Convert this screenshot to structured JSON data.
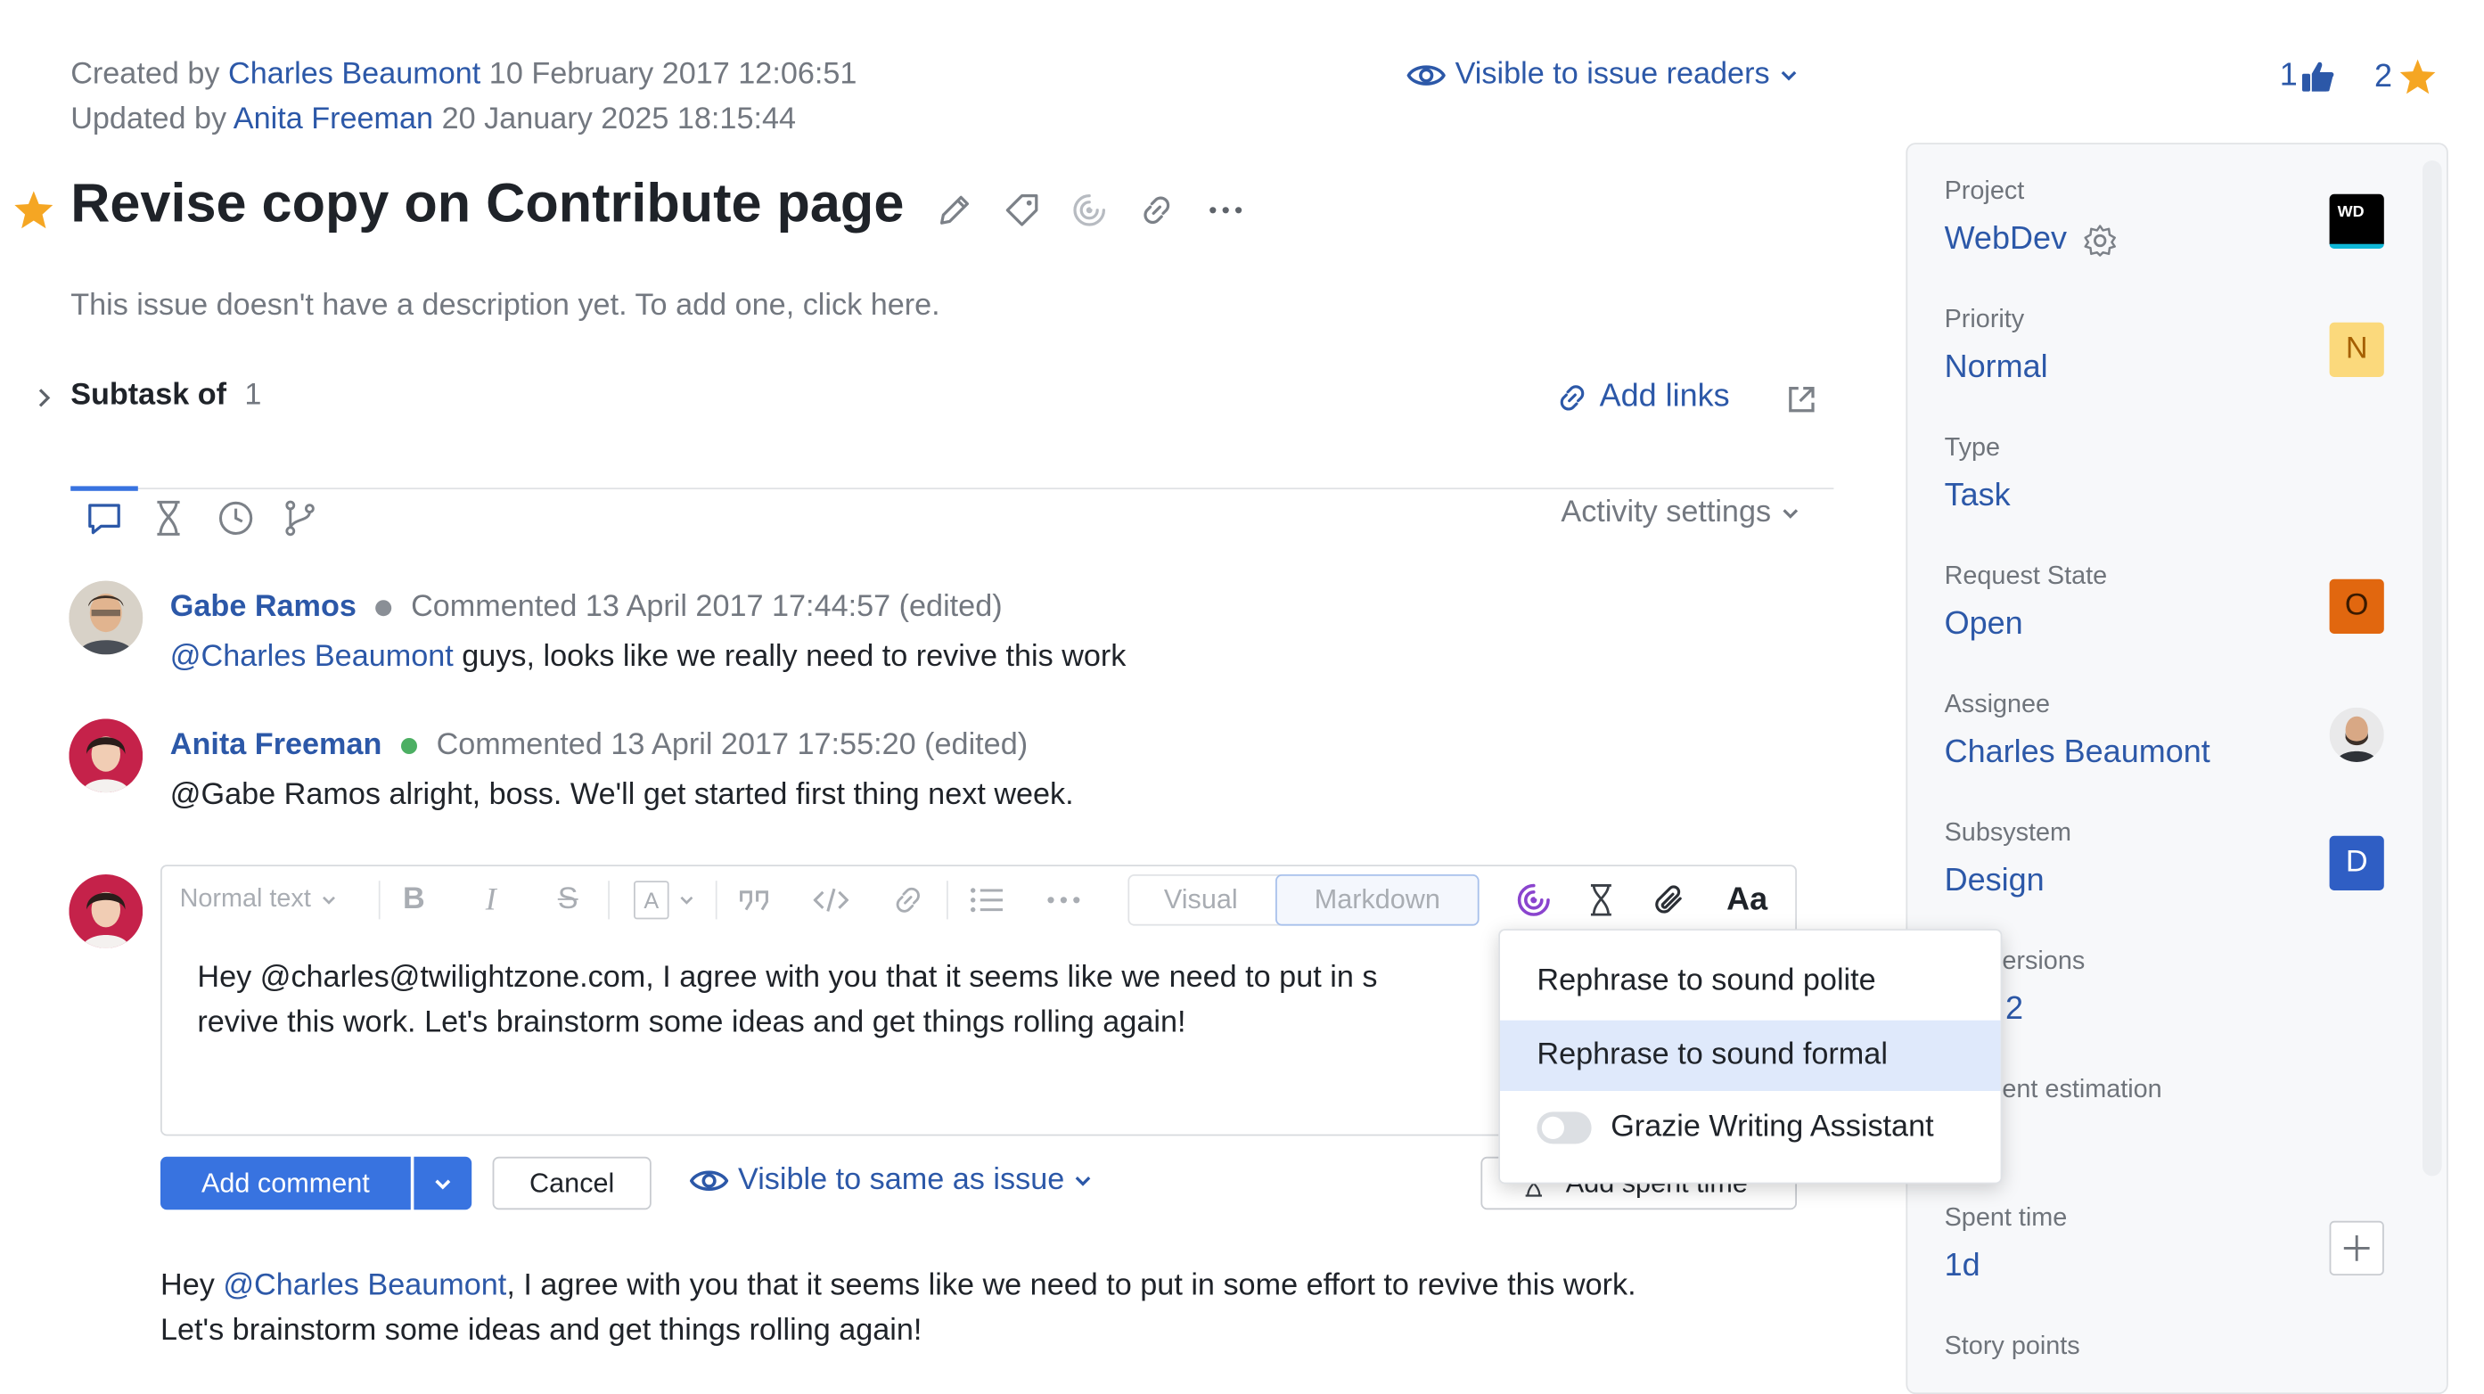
{
  "meta": {
    "created_prefix": "Created by",
    "created_author": "Charles Beaumont",
    "created_date": "10 February 2017 12:06:51",
    "updated_prefix": "Updated by",
    "updated_author": "Anita Freeman",
    "updated_date": "20 January 2025 18:15:44"
  },
  "visibility": {
    "label": "Visible to issue readers"
  },
  "counters": {
    "votes": "1",
    "stars": "2"
  },
  "issue": {
    "title": "Revise copy on Contribute page",
    "description_placeholder": "This issue doesn't have a description yet. To add one, click here.",
    "subtask_label": "Subtask of",
    "subtask_count": "1",
    "add_links": "Add links"
  },
  "activity": {
    "settings_label": "Activity settings"
  },
  "comments": [
    {
      "author": "Gabe Ramos",
      "status_color": "#8a8f96",
      "meta": "Commented 13 April 2017 17:44:57 (edited)",
      "mention": "@Charles Beaumont",
      "text": " guys, looks like we really need to revive this work"
    },
    {
      "author": "Anita Freeman",
      "status_color": "#4caf63",
      "meta": "Commented 13 April 2017 17:55:20 (edited)",
      "text": "@Gabe Ramos alright, boss. We'll get started first thing next week."
    }
  ],
  "editor": {
    "text_style": "Normal text",
    "mode_visual": "Visual",
    "mode_markdown": "Markdown",
    "font_toggle": "Aa",
    "content_line1": "Hey @charles@twilightzone.com, I agree with you that it seems like we need to put in s",
    "content_line2": "revive this work. Let's brainstorm some ideas and get things rolling again!",
    "add_comment": "Add comment",
    "cancel": "Cancel",
    "visibility": "Visible to same as issue",
    "add_spent_time": "Add spent time"
  },
  "ai_menu": {
    "items": [
      "Rephrase to sound polite",
      "Rephrase to sound formal"
    ],
    "highlighted_index": 1,
    "toggle_label": "Grazie Writing Assistant",
    "toggle_on": false
  },
  "preview": {
    "prefix": "Hey ",
    "mention": "@Charles Beaumont",
    "line1_rest": ", I agree with you that it seems like we need to put in some effort to revive this work.",
    "line2": "Let's brainstorm some ideas and get things rolling again!"
  },
  "fields": {
    "project_label": "Project",
    "project_value": "WebDev",
    "project_badge": "WD",
    "priority_label": "Priority",
    "priority_value": "Normal",
    "priority_badge": "N",
    "type_label": "Type",
    "type_value": "Task",
    "state_label": "Request State",
    "state_value": "Open",
    "state_badge": "O",
    "assignee_label": "Assignee",
    "assignee_value": "Charles Beaumont",
    "subsystem_label": "Subsystem",
    "subsystem_value": "Design",
    "subsystem_badge": "D",
    "versions_label": "ersions",
    "versions_value": "2",
    "estimation_label": "ent estimation",
    "spent_label": "Spent time",
    "spent_value": "1d",
    "story_label": "Story points"
  },
  "colors": {
    "link": "#2c58a8",
    "primary_button": "#3873e0",
    "star": "#f5a623",
    "priority_badge": "#fbd97c",
    "state_badge": "#e1670f",
    "subsystem_badge": "#2f5ec4",
    "ai_icon": "#8a44ce",
    "menu_highlight": "#dfe9fb"
  },
  "icons": [
    "star-icon",
    "pencil-icon",
    "tag-icon",
    "ai-assistant-icon",
    "link-icon",
    "more-icon",
    "eye-icon",
    "thumbs-up-icon",
    "chevron-right-icon",
    "external-link-icon",
    "comment-icon",
    "hourglass-icon",
    "clock-icon",
    "vcs-branch-icon",
    "gear-icon",
    "paperclip-icon",
    "plus-icon"
  ]
}
